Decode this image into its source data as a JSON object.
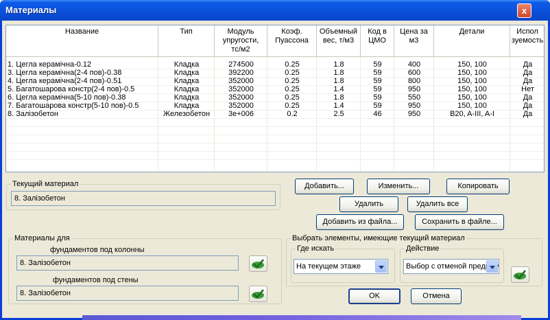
{
  "window": {
    "title": "Материалы",
    "close_label": "x"
  },
  "table": {
    "columns": [
      {
        "label": "Название"
      },
      {
        "label": "Тип"
      },
      {
        "label": "Модуль\nупругости,\nтс/м2"
      },
      {
        "label": "Коэф.\nПуассона"
      },
      {
        "label": "Объемный\nвес, т/м3"
      },
      {
        "label": "Код в\nЦМО"
      },
      {
        "label": "Цена за\nм3"
      },
      {
        "label": "Детали"
      },
      {
        "label": "Испол\nзуемость"
      }
    ],
    "rows": [
      [
        "1. Цегла керамічна-0.12",
        "Кладка",
        "274500",
        "0.25",
        "1.8",
        "59",
        "400",
        "150, 100",
        "Да"
      ],
      [
        "3. Цегла керамічна(2-4 пов)-0.38",
        "Кладка",
        "392200",
        "0.25",
        "1.8",
        "59",
        "600",
        "150, 100",
        "Да"
      ],
      [
        "4. Цегла керамічна(2-4 пов)-0.51",
        "Кладка",
        "352000",
        "0.25",
        "1.8",
        "59",
        "800",
        "150, 100",
        "Да"
      ],
      [
        "5. Багатошарова констр(2-4 пов)-0.5",
        "Кладка",
        "352000",
        "0.25",
        "1.4",
        "59",
        "950",
        "150, 100",
        "Нет"
      ],
      [
        "6. Цегла керамічна(5-10 пов)-0.38",
        "Кладка",
        "352000",
        "0.25",
        "1.8",
        "59",
        "550",
        "150, 100",
        "Да"
      ],
      [
        "7. Багатошарова констр(5-10 пов)-0.5",
        "Кладка",
        "352000",
        "0.25",
        "1.4",
        "59",
        "950",
        "150, 100",
        "Да"
      ],
      [
        "8. Залізобетон",
        "Железобетон",
        "3e+006",
        "0.2",
        "2.5",
        "46",
        "950",
        "B20, A-III, A-I",
        "Да"
      ]
    ]
  },
  "current_material": {
    "legend": "Текущий материал",
    "value": "8. Залізобетон"
  },
  "buttons": {
    "add": "Добавить...",
    "edit": "Изменить...",
    "copy": "Копировать",
    "delete": "Удалить",
    "delete_all": "Удалить все",
    "add_from_file": "Добавить из файла...",
    "save_to_file": "Сохранить в файле...",
    "ok": "OK",
    "cancel": "Отмена"
  },
  "materials_for": {
    "legend": "Материалы для",
    "columns_label": "фундаментов под колонны",
    "columns_value": "8. Залізобетон",
    "walls_label": "фундаментов под стены",
    "walls_value": "8. Залізобетон"
  },
  "select_elements": {
    "legend": "Выбрать элементы, имеющие текущий материал",
    "where_legend": "Где искать",
    "where_value": "На текущем этаже",
    "action_legend": "Действие",
    "action_value": "Выбор с отменой предыдущего"
  }
}
